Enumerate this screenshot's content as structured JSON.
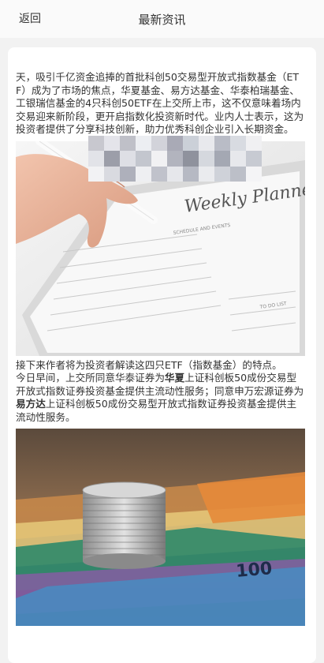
{
  "header": {
    "back_label": "返回",
    "title": "最新资讯"
  },
  "article": {
    "para1": "天，吸引千亿资金追捧的首批科创50交易型开放式指数基金（ETF）成为了市场的焦点，华夏基金、易方达基金、华泰柏瑞基金、工银瑞信基金的4只科创50ETF在上交所上市，这不仅意味着场内交易迎来新阶段，更开启指数化投资新时代。业内人士表示，这为投资者提供了分享科技创新，助力优秀科创企业引入长期资金。",
    "image1_desc_hidden": "",
    "para2_line1": "接下来作者将为投资者解读这四只ETF（指数基金）的特点。",
    "para2_a": "今日早间，上交所同意华泰证券为",
    "para2_b": "华夏",
    "para2_c": "上证科创板50成份交易型开放式指数证券投资基金提供主流动性服务；同意申万宏源证券为",
    "para2_d": "易方达",
    "para2_e": "上证科创板50成份交易型开放式指数证券投资基金提供主流动性服务。",
    "planner_text": "Weekly Planner",
    "planner_sub": "SCHEDULE AND EVENTS",
    "planner_todo": "TO DO LIST",
    "banknote_text": "100"
  },
  "colors": {
    "background": "#f2f2f2",
    "card": "#ffffff",
    "text": "#333333"
  }
}
